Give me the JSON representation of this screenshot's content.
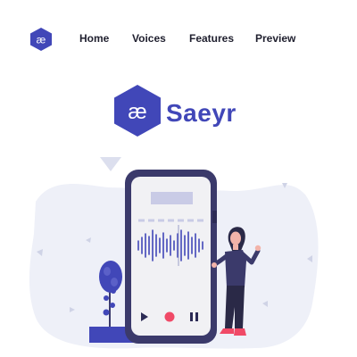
{
  "logo": {
    "glyph": "æ",
    "icon": "hexagon-logo-icon",
    "color": "#4147b8"
  },
  "nav": {
    "items": [
      {
        "label": "Home"
      },
      {
        "label": "Voices"
      },
      {
        "label": "Features"
      },
      {
        "label": "Preview"
      }
    ]
  },
  "hero": {
    "brand_name": "Saeyr",
    "brand_glyph": "æ"
  },
  "colors": {
    "accent": "#4147b8",
    "phone_frame": "#3b3a6b",
    "blob": "#eef0f8",
    "record": "#f04a67"
  }
}
